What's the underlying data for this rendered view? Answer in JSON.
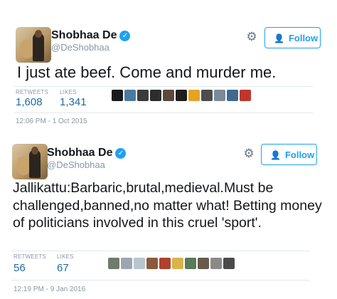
{
  "tweets": [
    {
      "author": "Shobhaa De",
      "verified_mark": "✓",
      "handle": "@DeShobhaa",
      "follow_label": "Follow",
      "text": "I just ate beef. Come and murder me.",
      "retweets_label": "RETWEETS",
      "retweets": "1,608",
      "likes_label": "LIKES",
      "likes": "1,341",
      "timestamp": "12:06 PM - 1 Oct 2015",
      "liker_avatars": [
        "#1a1a1a",
        "#4a7aa0",
        "#3b3b3b",
        "#2d2d2d",
        "#5b4a3a",
        "#1f1f1f",
        "#e6a323",
        "#4d4d4d",
        "#7a8a99",
        "#3f6a8f",
        "#c0362c"
      ]
    },
    {
      "author": "Shobhaa De",
      "verified_mark": "✓",
      "handle": "@DeShobhaa",
      "follow_label": "Follow",
      "text": "Jallikattu:Barbaric,brutal,medieval.Must be challenged,banned,no matter what! Betting money of politicians involved in this cruel 'sport'.",
      "retweets_label": "RETWEETS",
      "retweets": "56",
      "likes_label": "LIKES",
      "likes": "67",
      "timestamp": "12:19 PM - 9 Jan 2016",
      "liker_avatars": [
        "#6f7c6a",
        "#9aa7b3",
        "#b8c5cf",
        "#8a5a3a",
        "#b0402f",
        "#d9b44a",
        "#5a7a5a",
        "#6a5a4a",
        "#8a8a8a",
        "#4a4a4a"
      ]
    }
  ],
  "icons": {
    "gear": "gear-icon",
    "follow": "add-user-icon"
  },
  "colors": {
    "accent": "#1da1f2",
    "stat_value": "#1b6a9e",
    "muted": "#8899a6"
  }
}
